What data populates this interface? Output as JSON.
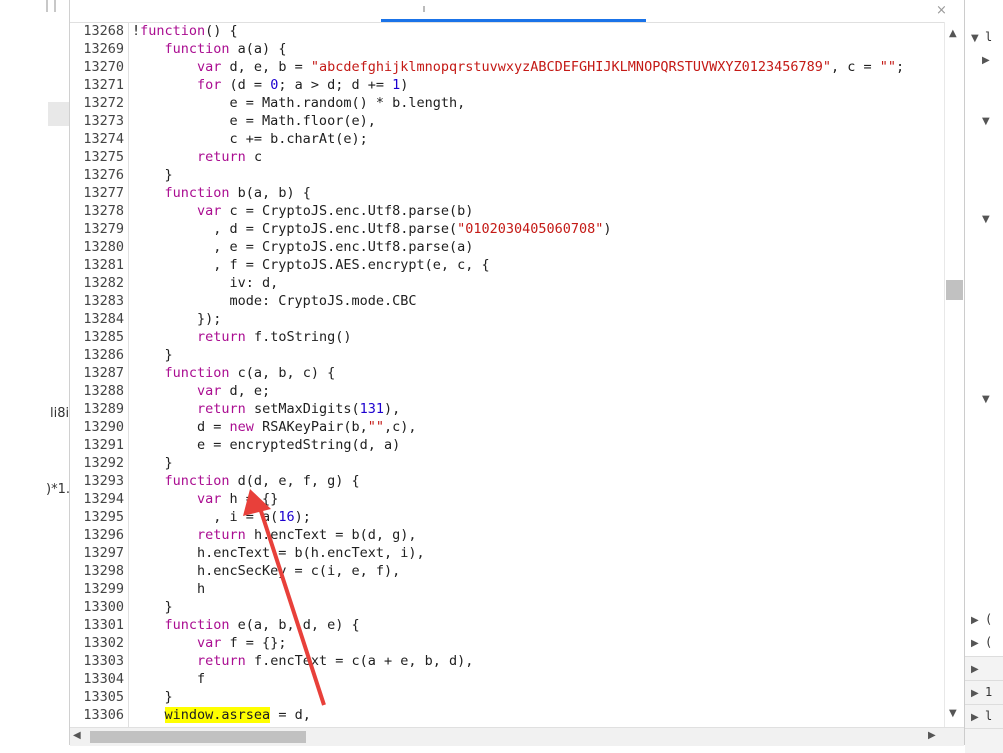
{
  "left_fragments": {
    "frag1": "li8i",
    "frag2": ")*1."
  },
  "top_bar": {
    "close_icon": "×"
  },
  "code_lines": [
    {
      "num": "13268",
      "code": "!function() {"
    },
    {
      "num": "13269",
      "code": "    function a(a) {"
    },
    {
      "num": "13270",
      "code": "        var d, e, b = \"abcdefghijklmnopqrstuvwxyzABCDEFGHIJKLMNOPQRSTUVWXYZ0123456789\", c = \"\";"
    },
    {
      "num": "13271",
      "code": "        for (d = 0; a > d; d += 1)"
    },
    {
      "num": "13272",
      "code": "            e = Math.random() * b.length,"
    },
    {
      "num": "13273",
      "code": "            e = Math.floor(e),"
    },
    {
      "num": "13274",
      "code": "            c += b.charAt(e);"
    },
    {
      "num": "13275",
      "code": "        return c"
    },
    {
      "num": "13276",
      "code": "    }"
    },
    {
      "num": "13277",
      "code": "    function b(a, b) {"
    },
    {
      "num": "13278",
      "code": "        var c = CryptoJS.enc.Utf8.parse(b)"
    },
    {
      "num": "13279",
      "code": "          , d = CryptoJS.enc.Utf8.parse(\"0102030405060708\")"
    },
    {
      "num": "13280",
      "code": "          , e = CryptoJS.enc.Utf8.parse(a)"
    },
    {
      "num": "13281",
      "code": "          , f = CryptoJS.AES.encrypt(e, c, {"
    },
    {
      "num": "13282",
      "code": "            iv: d,"
    },
    {
      "num": "13283",
      "code": "            mode: CryptoJS.mode.CBC"
    },
    {
      "num": "13284",
      "code": "        });"
    },
    {
      "num": "13285",
      "code": "        return f.toString()"
    },
    {
      "num": "13286",
      "code": "    }"
    },
    {
      "num": "13287",
      "code": "    function c(a, b, c) {"
    },
    {
      "num": "13288",
      "code": "        var d, e;"
    },
    {
      "num": "13289",
      "code": "        return setMaxDigits(131),"
    },
    {
      "num": "13290",
      "code": "        d = new RSAKeyPair(b,\"\",c),"
    },
    {
      "num": "13291",
      "code": "        e = encryptedString(d, a)"
    },
    {
      "num": "13292",
      "code": "    }"
    },
    {
      "num": "13293",
      "code": "    function d(d, e, f, g) {"
    },
    {
      "num": "13294",
      "code": "        var h = {}"
    },
    {
      "num": "13295",
      "code": "          , i = a(16);"
    },
    {
      "num": "13296",
      "code": "        return h.encText = b(d, g),"
    },
    {
      "num": "13297",
      "code": "        h.encText = b(h.encText, i),"
    },
    {
      "num": "13298",
      "code": "        h.encSecKey = c(i, e, f),"
    },
    {
      "num": "13299",
      "code": "        h"
    },
    {
      "num": "13300",
      "code": "    }"
    },
    {
      "num": "13301",
      "code": "    function e(a, b, d, e) {"
    },
    {
      "num": "13302",
      "code": "        var f = {};"
    },
    {
      "num": "13303",
      "code": "        return f.encText = c(a + e, b, d),"
    },
    {
      "num": "13304",
      "code": "        f"
    },
    {
      "num": "13305",
      "code": "    }"
    },
    {
      "num": "13306",
      "code": "    window.asrsea = d,"
    }
  ],
  "highlight": "window.asrsea",
  "right_panel": {
    "top_frag": "l",
    "row_frags": [
      "(",
      "(",
      "",
      "1",
      "l"
    ]
  },
  "colors": {
    "keyword": "#aa0d91",
    "string": "#c41a16",
    "number": "#1c00cf",
    "highlight": "#ffff00",
    "arrow": "#e8403a",
    "accent": "#1a73e8"
  }
}
